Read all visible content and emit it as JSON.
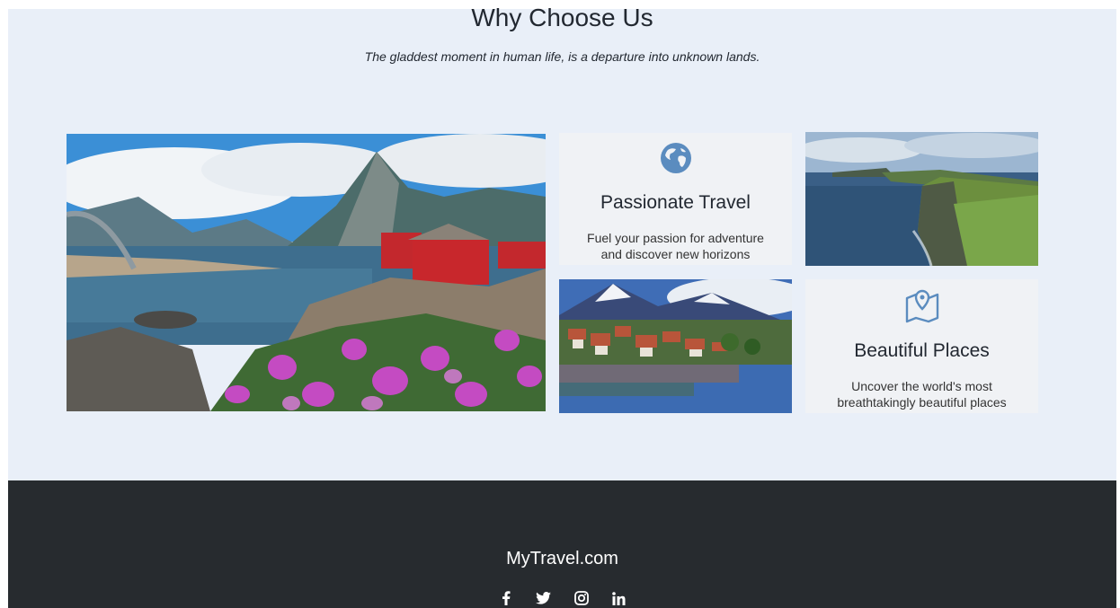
{
  "section": {
    "title": "Why Choose Us",
    "subtitle": "The gladdest moment in human life, is a departure into unknown lands."
  },
  "cards": [
    {
      "icon": "globe-icon",
      "title": "Passionate Travel",
      "text": "Fuel your passion for adventure and discover new horizons"
    },
    {
      "icon": "map-pin-icon",
      "title": "Beautiful Places",
      "text": "Uncover the world's most breathtakingly beautiful places"
    }
  ],
  "footer": {
    "brand": "MyTravel.com",
    "social": [
      "facebook-icon",
      "twitter-icon",
      "instagram-icon",
      "linkedin-icon"
    ]
  },
  "colors": {
    "section_bg": "#e9eff8",
    "card_bg": "#f0f2f5",
    "accent_icon": "#5b8cbf",
    "footer_bg": "#272b2f"
  }
}
